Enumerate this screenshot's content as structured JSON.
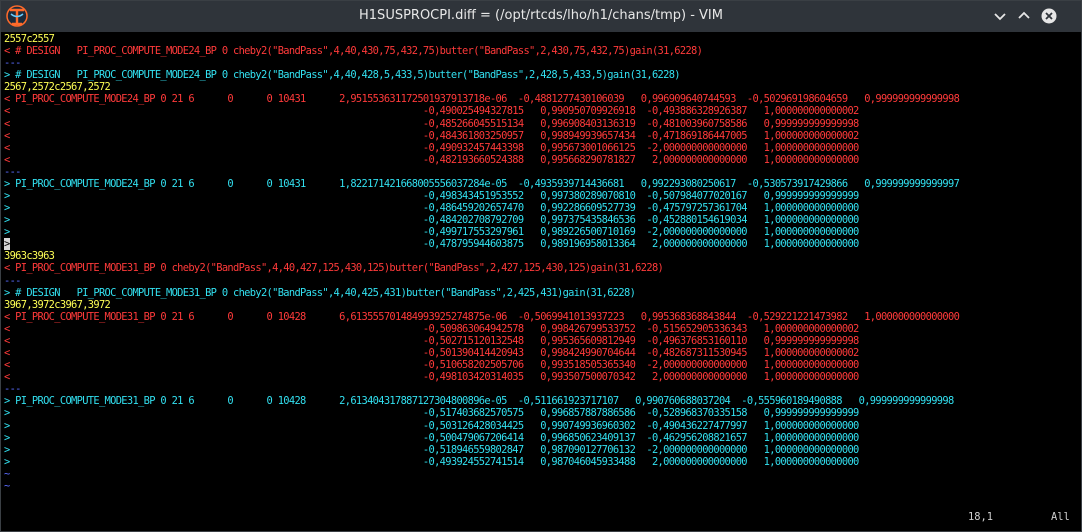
{
  "window": {
    "title": "H1SUSPROCPI.diff = (/opt/rtcds/lho/h1/chans/tmp) - VIM"
  },
  "colors": {
    "removed": "#ff3a3a",
    "added": "#32e0f0",
    "hunk": "#ffff55",
    "separator": "#5a6cff"
  },
  "buffer": [
    {
      "c": "y",
      "t": "2557c2557"
    },
    {
      "c": "r",
      "t": "< # DESIGN   PI_PROC_COMPUTE_MODE24_BP 0 cheby2(\"BandPass\",4,40,430,75,432,75)butter(\"BandPass\",2,430,75,432,75)gain(31,6228)"
    },
    {
      "c": "b",
      "t": "---"
    },
    {
      "c": "c",
      "t": "> # DESIGN   PI_PROC_COMPUTE_MODE24_BP 0 cheby2(\"BandPass\",4,40,428,5,433,5)butter(\"BandPass\",2,428,5,433,5)gain(31,6228)"
    },
    {
      "c": "y",
      "t": "2567,2572c2567,2572"
    },
    {
      "c": "r",
      "t": "< PI_PROC_COMPUTE_MODE24_BP 0 21 6      0      0 10431      2,951553631172501937913718e-06  -0,4881277430106039   0,996909640744593  -0,502969198604659   0,999999999999998"
    },
    {
      "c": "r",
      "t": "<                                                                          -0,490025494327815   0,990950709926918  -0,493886328926387   1,000000000000002"
    },
    {
      "c": "r",
      "t": "<                                                                          -0,485266045515134   0,996908403136319  -0,481003960758586   0,999999999999998"
    },
    {
      "c": "r",
      "t": "<                                                                          -0,484361803250957   0,998949939657434  -0,471869186447005   1,000000000000002"
    },
    {
      "c": "r",
      "t": "<                                                                          -0,490932457443398   0,995673001066125  -2,000000000000000   1,000000000000000"
    },
    {
      "c": "r",
      "t": "<                                                                          -0,482193660524388   0,995668290781827   2,000000000000000   1,000000000000000"
    },
    {
      "c": "b",
      "t": "---"
    },
    {
      "c": "c",
      "t": "> PI_PROC_COMPUTE_MODE24_BP 0 21 6      0      0 10431      1,822171421668005556037284e-05  -0,4935939714436681   0,992293080250617  -0,530573917429866   0,999999999999997"
    },
    {
      "c": "c",
      "t": ">                                                                          -0,498343451953552   0,997380289070810  -0,507984077020167   0,999999999999999"
    },
    {
      "c": "c",
      "t": ">                                                                          -0,486459202657470   0,992286609527739  -0,475797257361704   1,000000000000000"
    },
    {
      "c": "c",
      "t": ">                                                                          -0,484202708792709   0,997375435846536  -0,452880154619034   1,000000000000000"
    },
    {
      "c": "c",
      "t": ">                                                                          -0,499717553297961   0,989226500710169  -2,000000000000000   1,000000000000000"
    },
    {
      "c": "c",
      "t": ">                                                                          -0,478795944603875   0,989196958013364   2,000000000000000   1,000000000000000"
    },
    {
      "c": "y",
      "t": "3963c3963"
    },
    {
      "c": "r",
      "t": "< PI_PROC_COMPUTE_MODE31_BP 0 cheby2(\"BandPass\",4,40,427,125,430,125)butter(\"BandPass\",2,427,125,430,125)gain(31,6228)"
    },
    {
      "c": "b",
      "t": "---"
    },
    {
      "c": "c",
      "t": "> # DESIGN   PI_PROC_COMPUTE_MODE31_BP 0 cheby2(\"BandPass\",4,40,425,431)butter(\"BandPass\",2,425,431)gain(31,6228)"
    },
    {
      "c": "y",
      "t": "3967,3972c3967,3972"
    },
    {
      "c": "r",
      "t": "< PI_PROC_COMPUTE_MODE31_BP 0 21 6      0      0 10428      6,613555701484993925274875e-06  -0,5069941013937223   0,995368368843844  -0,529221221473982   1,000000000000000"
    },
    {
      "c": "r",
      "t": "<                                                                          -0,509863064942578   0,998426799533752  -0,515652905336343   1,000000000000002"
    },
    {
      "c": "r",
      "t": "<                                                                          -0,502715120132548   0,995365609812949  -0,496376853160110   0,999999999999998"
    },
    {
      "c": "r",
      "t": "<                                                                          -0,501390414420943   0,998424990704644  -0,482687311530945   1,000000000000002"
    },
    {
      "c": "r",
      "t": "<                                                                          -0,510658202505706   0,993518505365340  -2,000000000000000   1,000000000000000"
    },
    {
      "c": "r",
      "t": "<                                                                          -0,498103420314035   0,993507500070342   2,000000000000000   1,000000000000000"
    },
    {
      "c": "b",
      "t": "---"
    },
    {
      "c": "c",
      "t": "> PI_PROC_COMPUTE_MODE31_BP 0 21 6      0      0 10428      2,613404317887127304800896e-05  -0,511661923717107   0,990760688037204  -0,555960189490888   0,999999999999998"
    },
    {
      "c": "c",
      "t": ">                                                                          -0,517403682570575   0,996857887886586  -0,528968370335158   0,999999999999999"
    },
    {
      "c": "c",
      "t": ">                                                                          -0,503126428034425   0,990749936960302  -0,490436227477997   1,000000000000000"
    },
    {
      "c": "c",
      "t": ">                                                                          -0,500479067206414   0,996850623409137  -0,462956208821657   1,000000000000000"
    },
    {
      "c": "c",
      "t": ">                                                                          -0,518946559802847   0,987090127706132  -2,000000000000000   1,000000000000000"
    },
    {
      "c": "c",
      "t": ">                                                                          -0,493924552741514   0,987046045933488   2,000000000000000   1,000000000000000"
    },
    {
      "c": "b",
      "t": "~"
    },
    {
      "c": "b",
      "t": "~"
    }
  ],
  "status": {
    "position": "18,1",
    "scroll": "All"
  }
}
